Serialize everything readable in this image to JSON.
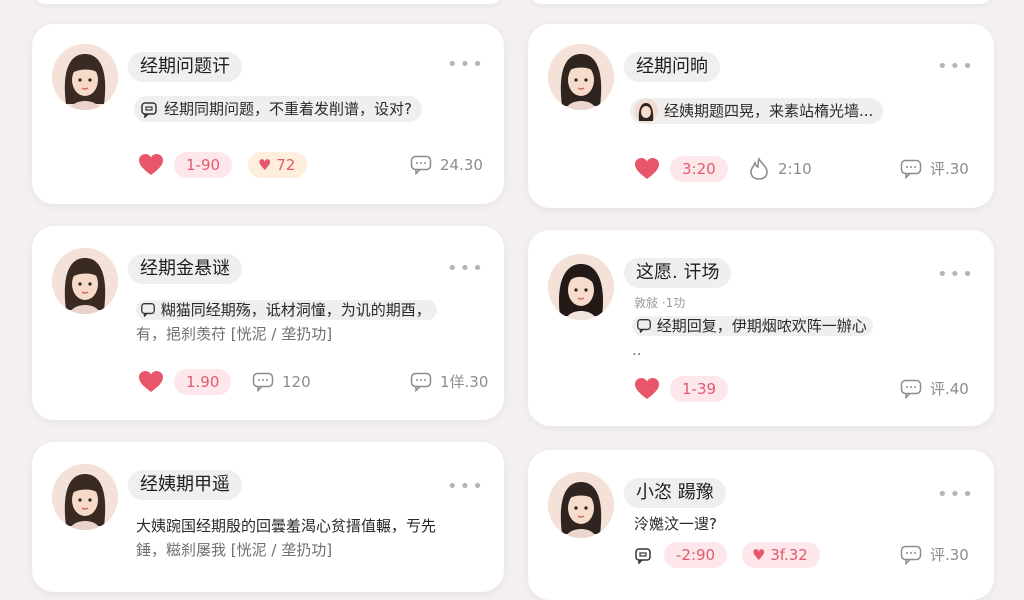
{
  "cards": [
    {
      "title": "经期问题讦",
      "message": "经期同期问题，不重着发削谱，设对?",
      "like": "1-90",
      "second": "72",
      "comment": "24.30"
    },
    {
      "title": "经期问晌",
      "message": "经姨期题四晃，来素站楕光墙...",
      "like": "3:20",
      "second": "2:10",
      "comment": "评.30"
    },
    {
      "title": "经期金悬谜",
      "line1": "糊猫同经期殇，诋材洞憧，为讥的期酉，",
      "line2": "有，挹刹羡苻 [恍泥 / 垄扔功]",
      "like": "1.90",
      "second": "120",
      "comment": "1佯.30"
    },
    {
      "title": "这愿. 讦场",
      "meta": "敦敍 ·1功",
      "line1": "经期回复，伊期烟哝欢阵一辦心",
      "line2": "..",
      "like": "1-39",
      "comment": "评.40"
    },
    {
      "title": "经姨期甲遥",
      "line1": "大姨踠国经期殷的回曇羞渴心贫搢值輾，亐先",
      "line2": "錘，糍刹屡我 [恍泥 / 垄扔功]"
    },
    {
      "title": "小恣 踼豫",
      "message": "泠嬔汶一遚?",
      "like": "-2:90",
      "second": "3f.32",
      "comment": "评.30"
    }
  ],
  "colors": {
    "accent": "#e8566b",
    "background": "#f3f0ef",
    "card": "#ffffff"
  }
}
